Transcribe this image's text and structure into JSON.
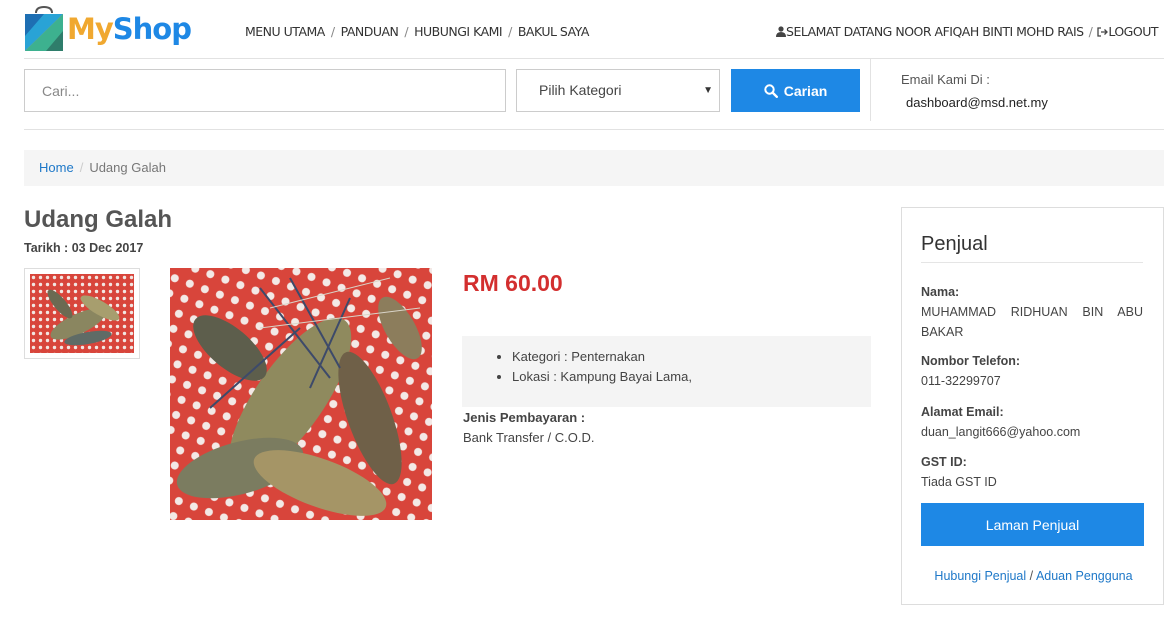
{
  "brand": {
    "my": "My",
    "shop": "Shop"
  },
  "nav": {
    "items": [
      "MENU UTAMA",
      "PANDUAN",
      "HUBUNGI KAMI",
      "BAKUL SAYA"
    ],
    "sep": "/"
  },
  "user": {
    "welcome": "SELAMAT DATANG NOOR AFIQAH BINTI MOHD RAIS",
    "sep": "/",
    "logout": "LOGOUT"
  },
  "search": {
    "placeholder": "Cari...",
    "category": "Pilih Kategori",
    "button": "Carian"
  },
  "contact": {
    "label": "Email Kami Di :",
    "email": "dashboard@msd.net.my"
  },
  "breadcrumb": {
    "home": "Home",
    "sep": "/",
    "current": "Udang Galah"
  },
  "product": {
    "title": "Udang Galah",
    "date": "Tarikh : 03 Dec 2017",
    "price": "RM 60.00",
    "details": [
      "Kategori : Penternakan",
      "Lokasi : Kampung Bayai Lama,"
    ],
    "payment_label": "Jenis Pembayaran :",
    "payment_value": "Bank Transfer / C.O.D."
  },
  "seller": {
    "heading": "Penjual",
    "name_label": "Nama:",
    "name": "MUHAMMAD RIDHUAN BIN ABU BAKAR",
    "phone_label": "Nombor Telefon:",
    "phone": "011-32299707",
    "email_label": "Alamat Email:",
    "email": "duan_langit666@yahoo.com",
    "gst_label": "GST ID:",
    "gst": "Tiada GST ID",
    "button": "Laman Penjual",
    "link_contact": "Hubungi Penjual",
    "link_sep": "/",
    "link_report": "Aduan Pengguna"
  },
  "colors": {
    "accent": "#1e88e5",
    "price": "#d32f2f",
    "logo_orange": "#f0a830",
    "link": "#1e78c8"
  },
  "icons": {
    "user": "user-icon",
    "logout": "logout-icon",
    "search": "search-icon",
    "caret": "caret-down-icon"
  }
}
